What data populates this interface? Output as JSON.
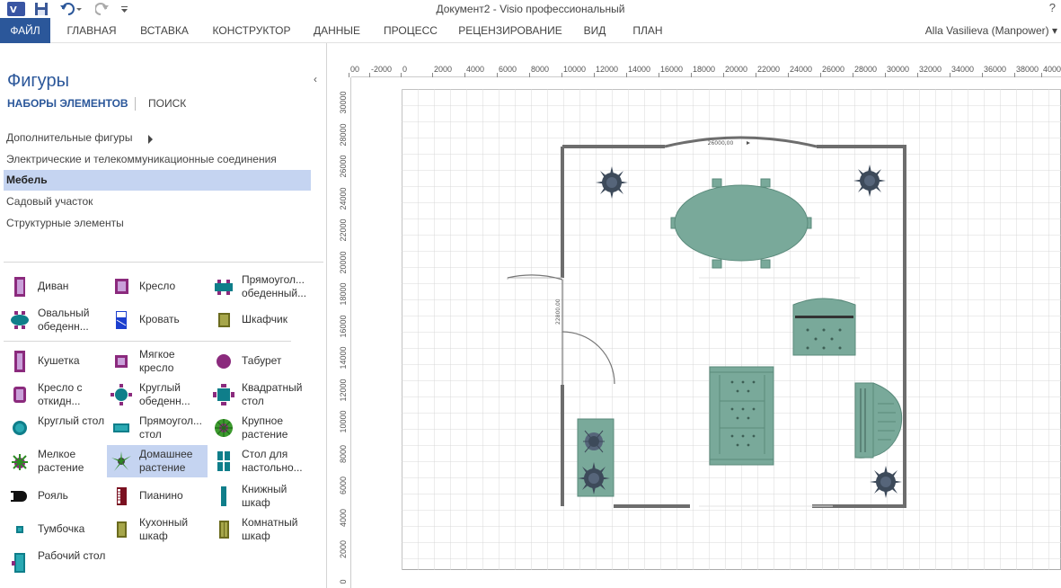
{
  "app": {
    "title": "Документ2 -  Visio профессиональный",
    "help": "?",
    "user": "Alla Vasilieva (Manpower)"
  },
  "ribbon": {
    "tabs": [
      "ФАЙЛ",
      "ГЛАВНАЯ",
      "ВСТАВКА",
      "КОНСТРУКТОР",
      "ДАННЫЕ",
      "ПРОЦЕСС",
      "РЕЦЕНЗИРОВАНИЕ",
      "ВИД",
      "ПЛАН"
    ]
  },
  "shapes_pane": {
    "title": "Фигуры",
    "tab_sets": "НАБОРЫ ЭЛЕМЕНТОВ",
    "tab_search": "ПОИСК",
    "stencils": [
      "Дополнительные фигуры",
      "Электрические и телекоммуникационные соединения",
      "Мебель",
      "Садовый участок",
      "Структурные элементы"
    ],
    "active_stencil": "Мебель",
    "shapes": [
      {
        "label": "Диван",
        "icon": "sofa-icon"
      },
      {
        "label": "Кресло",
        "icon": "armchair-icon"
      },
      {
        "label": "Прямоугол... обеденный...",
        "icon": "rect-dining-table-icon"
      },
      {
        "label": "Овальный обеденн...",
        "icon": "oval-dining-table-icon"
      },
      {
        "label": "Кровать",
        "icon": "bed-icon"
      },
      {
        "label": "Шкафчик",
        "icon": "cabinet-icon"
      },
      {
        "label": "Кушетка",
        "icon": "couch-icon"
      },
      {
        "label": "Мягкое кресло",
        "icon": "soft-chair-icon"
      },
      {
        "label": "Табурет",
        "icon": "stool-icon"
      },
      {
        "label": "Кресло с откидн...",
        "icon": "recliner-icon"
      },
      {
        "label": "Круглый обеденн...",
        "icon": "round-dining-table-icon"
      },
      {
        "label": "Квадратный стол",
        "icon": "square-table-icon"
      },
      {
        "label": "Круглый стол",
        "icon": "round-table-icon"
      },
      {
        "label": "Прямоугол... стол",
        "icon": "rect-table-icon"
      },
      {
        "label": "Крупное растение",
        "icon": "large-plant-icon"
      },
      {
        "label": "Мелкое растение",
        "icon": "small-plant-icon"
      },
      {
        "label": "Домашнее растение",
        "icon": "houseplant-icon"
      },
      {
        "label": "Стол для настольно...",
        "icon": "game-table-icon"
      },
      {
        "label": "Рояль",
        "icon": "grand-piano-icon"
      },
      {
        "label": "Пианино",
        "icon": "piano-icon"
      },
      {
        "label": "Книжный шкаф",
        "icon": "bookcase-icon"
      },
      {
        "label": "Тумбочка",
        "icon": "nightstand-icon"
      },
      {
        "label": "Кухонный шкаф",
        "icon": "kitchen-cabinet-icon"
      },
      {
        "label": "Комнатный шкаф",
        "icon": "room-cabinet-icon"
      },
      {
        "label": "Рабочий стол",
        "icon": "desk-icon"
      }
    ],
    "selected_shape": "Домашнее растение"
  },
  "rulers": {
    "top": [
      "00",
      "-2000",
      "0",
      "2000",
      "4000",
      "6000",
      "8000",
      "10000",
      "12000",
      "14000",
      "16000",
      "18000",
      "20000",
      "22000",
      "24000",
      "26000",
      "28000",
      "30000",
      "32000",
      "34000",
      "36000",
      "38000",
      "4000"
    ],
    "left": [
      "30000",
      "28000",
      "26000",
      "24000",
      "22000",
      "20000",
      "18000",
      "16000",
      "14000",
      "12000",
      "10000",
      "8000",
      "6000",
      "4000",
      "2000",
      "0"
    ]
  },
  "drawing": {
    "dimension_top": "26000,00",
    "dimension_door": "22800,00"
  },
  "colors": {
    "accent": "#2b579a",
    "furniture": "#79a99a",
    "wall": "#6d6d6d"
  }
}
